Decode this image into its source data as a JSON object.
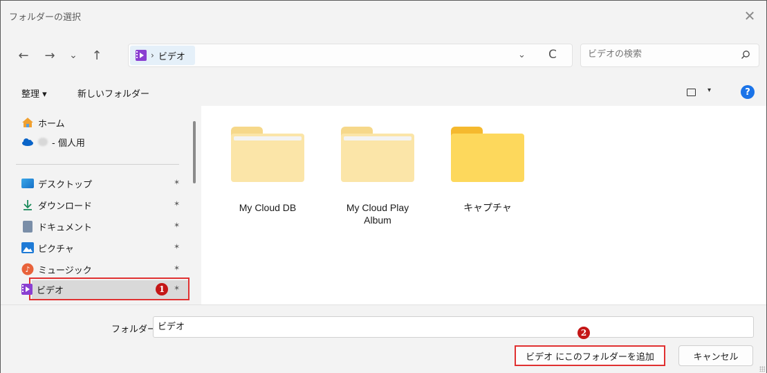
{
  "window": {
    "title": "フォルダーの選択",
    "close_glyph": "✕"
  },
  "nav": {
    "back": "←",
    "forward": "→",
    "recent": "⌄",
    "up": "↑",
    "breadcrumb_sep": "›",
    "breadcrumb": "ビデオ",
    "dropdown": "⌄",
    "refresh": "C",
    "search_placeholder": "ビデオの検索"
  },
  "toolbar": {
    "organize": "整理 ▾",
    "new_folder": "新しいフォルダー",
    "view_dropdown": "▾",
    "help": "?"
  },
  "sidebar": {
    "home": "ホーム",
    "cloud": "- 個人用",
    "items": [
      {
        "label": "デスクトップ",
        "icon": "desktop-icon"
      },
      {
        "label": "ダウンロード",
        "icon": "download-icon"
      },
      {
        "label": "ドキュメント",
        "icon": "document-icon"
      },
      {
        "label": "ピクチャ",
        "icon": "pictures-icon"
      },
      {
        "label": "ミュージック",
        "icon": "music-icon"
      },
      {
        "label": "ビデオ",
        "icon": "videos-icon"
      }
    ],
    "pin_glyph": "📌",
    "badge1": "1"
  },
  "folders": [
    {
      "name": "My Cloud DB",
      "color": "#fbe5a8",
      "tab_color": "#f6d88a"
    },
    {
      "name": "My Cloud Play Album",
      "color": "#fbe5a8",
      "tab_color": "#f6d88a"
    },
    {
      "name": "キャプチャ",
      "color": "#fdd85c",
      "tab_color": "#f5b92e"
    }
  ],
  "bottom": {
    "folder_label": "フォルダー:",
    "folder_value": "ビデオ",
    "add_button": "ビデオ にこのフォルダーを追加",
    "cancel_button": "キャンセル",
    "badge2": "2"
  },
  "colors": {
    "accent": "#1a73e8",
    "highlight": "#e03030",
    "video": "#8a3fd1"
  }
}
